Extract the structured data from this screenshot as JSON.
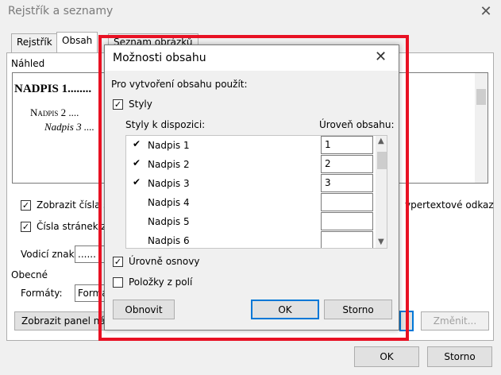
{
  "window": {
    "title": "Rejstřík a seznamy"
  },
  "tabs": [
    {
      "label": "Rejstřík"
    },
    {
      "label": "Obsah"
    },
    {
      "label": "Seznam obrázků"
    }
  ],
  "main": {
    "preview_label": "Náhled",
    "preview_lines": [
      "NADPIS 1........",
      "Nadpis 2 ....",
      "Nadpis 3 ...."
    ],
    "show_page_numbers": "Zobrazit čísla s",
    "align_page_numbers": "Čísla stránek z",
    "hyperlink_text": "ypertextové odkaz",
    "leader_label": "Vodicí znak",
    "leader_value": "......",
    "general_label": "Obecné",
    "formats_label": "Formáty:",
    "formats_value": "Forma",
    "show_toolbar_button": "Zobrazit panel ná",
    "modify_button": "Změnit...",
    "ok_button": "OK",
    "cancel_button": "Storno"
  },
  "dialog": {
    "title": "Možnosti obsahu",
    "build_from": "Pro vytvoření obsahu použít:",
    "styles_label": "Styly",
    "available_styles": "Styly k dispozici:",
    "toc_level": "Úroveň obsahu:",
    "rows": [
      {
        "mark": "✔",
        "name": "Nadpis 1",
        "level": "1"
      },
      {
        "mark": "✔",
        "name": "Nadpis 2",
        "level": "2"
      },
      {
        "mark": "✔",
        "name": "Nadpis 3",
        "level": "3"
      },
      {
        "mark": "",
        "name": "Nadpis 4",
        "level": ""
      },
      {
        "mark": "",
        "name": "Nadpis 5",
        "level": ""
      },
      {
        "mark": "",
        "name": "Nadpis 6",
        "level": ""
      }
    ],
    "outline_levels": "Úrovně osnovy",
    "field_entries": "Položky z polí",
    "reset_button": "Obnovit",
    "ok_button": "OK",
    "cancel_button": "Storno",
    "check_mark": "✓"
  },
  "colors": {
    "highlight": "#e81123",
    "accent": "#0078d7"
  }
}
